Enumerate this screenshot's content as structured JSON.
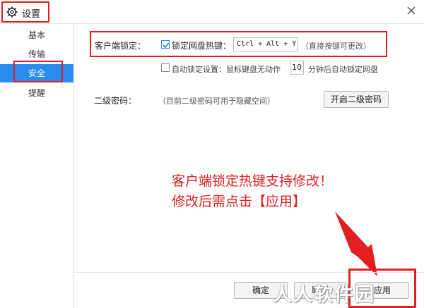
{
  "window": {
    "title": "设置",
    "close_icon": "close-icon",
    "settings_icon": "gear-icon"
  },
  "sidebar": {
    "items": [
      {
        "label": "基本",
        "active": false
      },
      {
        "label": "传输",
        "active": false
      },
      {
        "label": "安全",
        "active": true
      },
      {
        "label": "提醒",
        "active": false
      }
    ]
  },
  "client_lock": {
    "section_label": "客户端锁定：",
    "hotkey_checkbox_label": "锁定网盘热键：",
    "hotkey_checked": true,
    "hotkey_value": "Ctrl + Alt + Y",
    "hotkey_hint": "（直接按键可更改）",
    "auto_lock_label": "自动锁定设置：鼠标键盘无动作",
    "auto_lock_checked": false,
    "auto_lock_minutes": "10",
    "auto_lock_suffix": "分钟后自动锁定网盘"
  },
  "second_password": {
    "label": "二级密码：",
    "hint": "（目前二级密码可用于隐藏空间）",
    "enable_button": "开启二级密码"
  },
  "annotation": {
    "line1": "客户端锁定热键支持修改！",
    "line2": "修改后需点击【应用】"
  },
  "footer": {
    "ok_button": "确定",
    "cancel_button": "取消",
    "apply_button": "应用"
  },
  "watermark": "人人软件园",
  "colors": {
    "accent": "#2b8cf0",
    "highlight_red": "#e02020"
  }
}
